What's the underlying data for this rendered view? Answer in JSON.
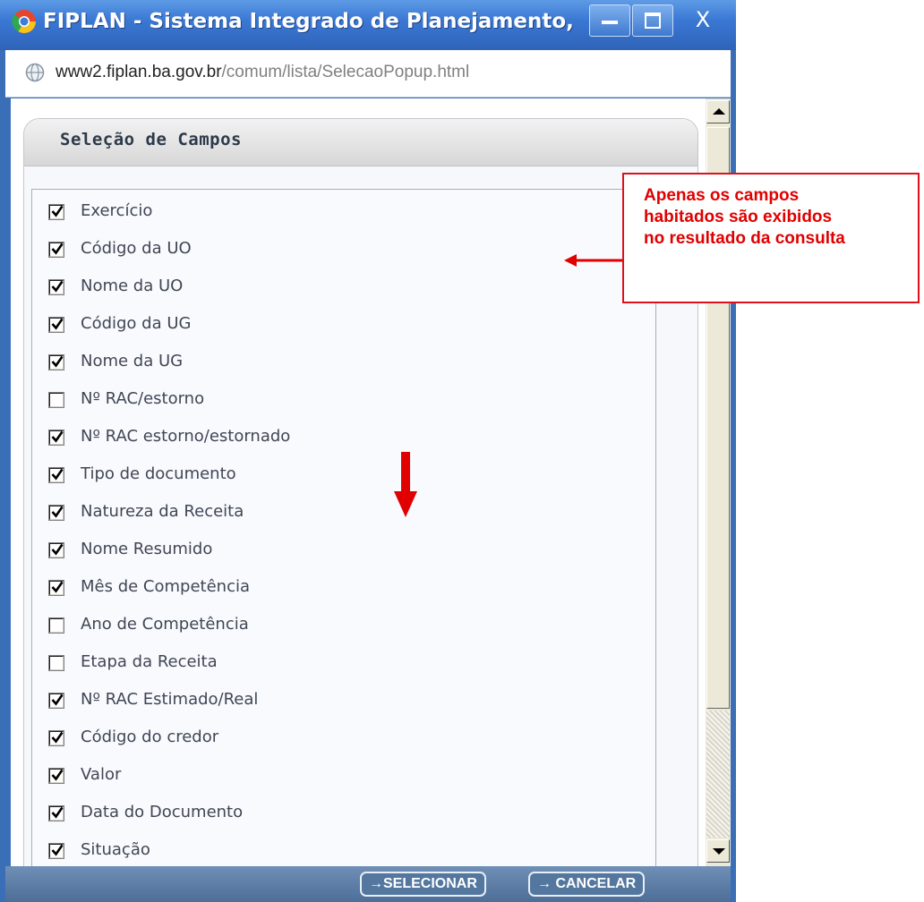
{
  "window": {
    "title": "FIPLAN - Sistema Integrado de Planejamento, C...",
    "close_glyph": "X",
    "icon": "chrome-icon"
  },
  "address": {
    "host": "www2.fiplan.ba.gov.br",
    "path": "/comum/lista/SelecaoPopup.html"
  },
  "panel": {
    "title": "Seleção de Campos",
    "fields": [
      {
        "label": "Exercício",
        "checked": true
      },
      {
        "label": "Código da UO",
        "checked": true
      },
      {
        "label": "Nome da UO",
        "checked": true
      },
      {
        "label": "Código da UG",
        "checked": true
      },
      {
        "label": "Nome da UG",
        "checked": true
      },
      {
        "label": "Nº RAC/estorno",
        "checked": false
      },
      {
        "label": "Nº RAC estorno/estornado",
        "checked": true
      },
      {
        "label": "Tipo de documento",
        "checked": true
      },
      {
        "label": "Natureza da Receita",
        "checked": true
      },
      {
        "label": "Nome Resumido",
        "checked": true
      },
      {
        "label": "Mês de Competência",
        "checked": true
      },
      {
        "label": "Ano de Competência",
        "checked": false
      },
      {
        "label": "Etapa da Receita",
        "checked": false
      },
      {
        "label": "Nº RAC Estimado/Real",
        "checked": true
      },
      {
        "label": "Código do credor",
        "checked": true
      },
      {
        "label": "Valor",
        "checked": true
      },
      {
        "label": "Data do Documento",
        "checked": true
      },
      {
        "label": "Situação",
        "checked": true
      }
    ]
  },
  "footer": {
    "select_label": "→SELECIONAR",
    "cancel_label": "→ CANCELAR"
  },
  "annotation": {
    "text": "Apenas os campos\nhabitados são exibidos\nno resultado da consulta",
    "color": "#e00000"
  }
}
